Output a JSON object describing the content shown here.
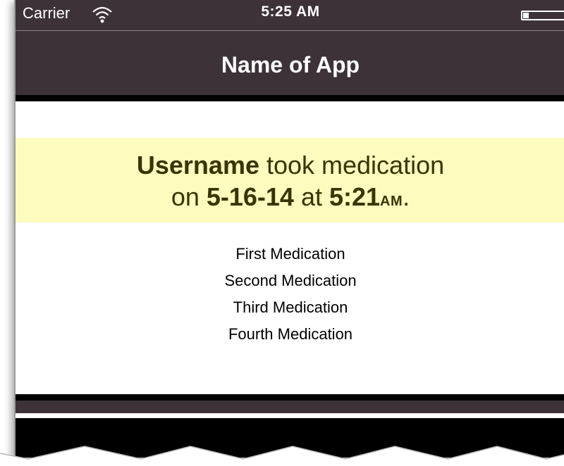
{
  "status_bar": {
    "carrier": "Carrier",
    "time": "5:25 AM",
    "wifi_icon": "wifi-icon",
    "battery_icon": "battery-icon"
  },
  "nav": {
    "title": "Name of App"
  },
  "banner": {
    "username": "Username",
    "text_took": " took medication",
    "text_on": "on ",
    "date": "5-16-14",
    "text_at": " at ",
    "time": "5:21",
    "ampm": "AM",
    "period": "."
  },
  "medications": [
    "First Medication",
    "Second Medication",
    "Third Medication",
    "Fourth Medication"
  ],
  "colors": {
    "nav_background": "#3d3238",
    "banner_background": "#fdfbbd",
    "banner_text": "#3a3400"
  }
}
